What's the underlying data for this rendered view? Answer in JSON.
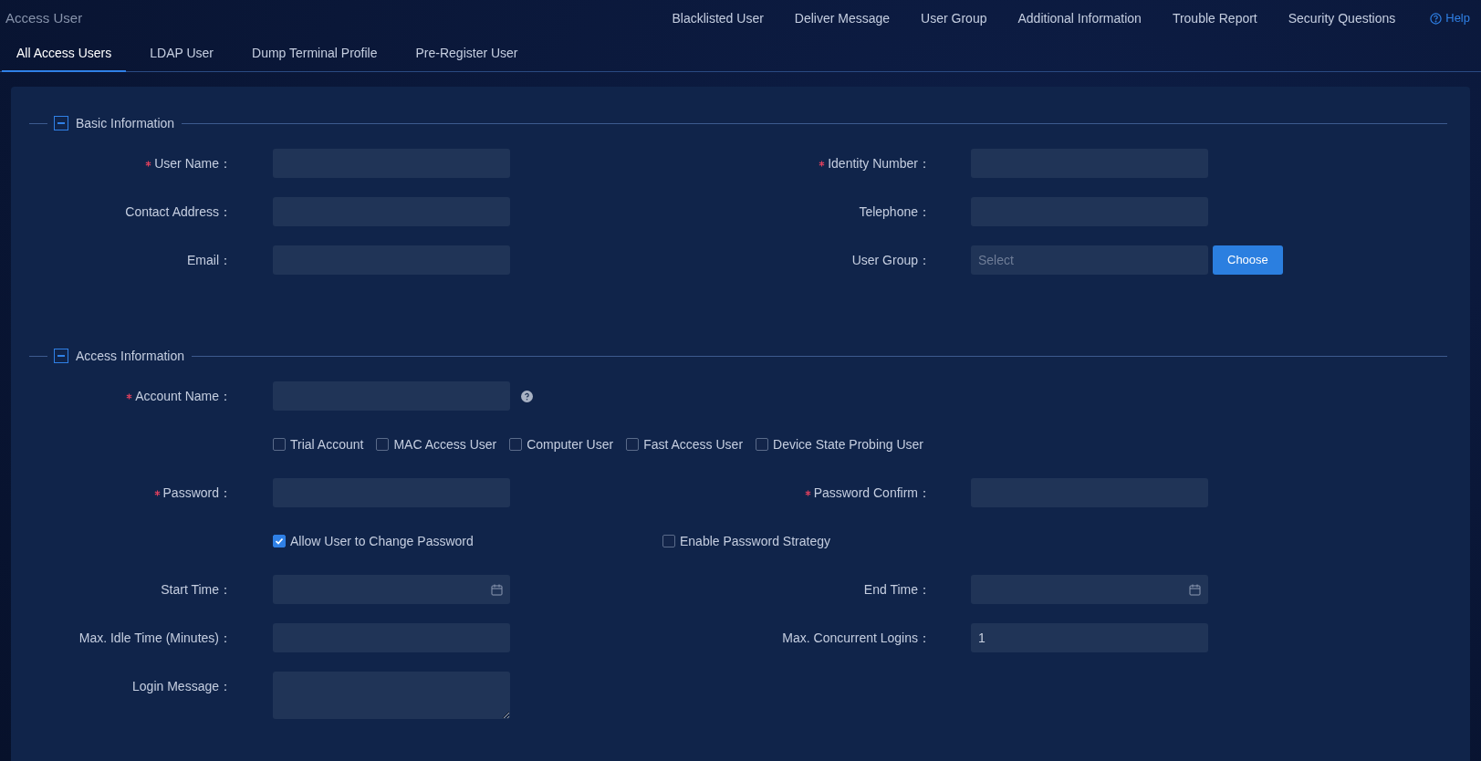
{
  "header": {
    "title": "Access User",
    "nav": [
      "Blacklisted User",
      "Deliver Message",
      "User Group",
      "Additional Information",
      "Trouble Report",
      "Security Questions"
    ],
    "help": "Help"
  },
  "tabs": [
    {
      "label": "All Access Users",
      "selected": true
    },
    {
      "label": "LDAP User",
      "selected": false
    },
    {
      "label": "Dump Terminal Profile",
      "selected": false
    },
    {
      "label": "Pre-Register User",
      "selected": false
    }
  ],
  "sections": [
    {
      "title": "Basic Information",
      "expanded": true,
      "rows": [
        {
          "kind": "fields",
          "fields": [
            {
              "label": "User Name：",
              "required": true,
              "kind": "text"
            },
            {
              "label": "Identity Number：",
              "required": true,
              "kind": "text"
            }
          ]
        },
        {
          "kind": "fields",
          "fields": [
            {
              "label": "Contact Address：",
              "required": false,
              "kind": "text"
            },
            {
              "label": "Telephone：",
              "required": false,
              "kind": "text"
            }
          ]
        },
        {
          "kind": "fields",
          "fields": [
            {
              "label": "Email：",
              "required": false,
              "kind": "text"
            },
            {
              "label": "User Group：",
              "required": false,
              "kind": "select",
              "placeholder": "Select",
              "button": "Choose"
            }
          ]
        }
      ]
    },
    {
      "title": "Access Information",
      "expanded": true,
      "rows": [
        {
          "kind": "fields",
          "fields": [
            {
              "label": "Account Name：",
              "required": true,
              "kind": "text",
              "help": true
            }
          ]
        },
        {
          "kind": "checkboxes",
          "items": [
            {
              "label": "Trial Account",
              "checked": false
            },
            {
              "label": "MAC Access User",
              "checked": false
            },
            {
              "label": "Computer User",
              "checked": false
            },
            {
              "label": "Fast Access User",
              "checked": false
            },
            {
              "label": "Device State Probing User",
              "checked": false
            }
          ]
        },
        {
          "kind": "fields",
          "fields": [
            {
              "label": "Password：",
              "required": true,
              "kind": "text"
            },
            {
              "label": "Password Confirm：",
              "required": true,
              "kind": "text"
            }
          ]
        },
        {
          "kind": "split_checkboxes",
          "items": [
            {
              "label": "Allow User to Change Password",
              "checked": true
            },
            {
              "label": "Enable Password Strategy",
              "checked": false
            }
          ]
        },
        {
          "kind": "fields",
          "fields": [
            {
              "label": "Start Time：",
              "required": false,
              "kind": "date"
            },
            {
              "label": "End Time：",
              "required": false,
              "kind": "date"
            }
          ]
        },
        {
          "kind": "fields",
          "fields": [
            {
              "label": "Max. Idle Time (Minutes)：",
              "required": false,
              "kind": "text"
            },
            {
              "label": "Max. Concurrent Logins：",
              "required": false,
              "kind": "text",
              "value": "1"
            }
          ]
        },
        {
          "kind": "fields",
          "fields": [
            {
              "label": "Login Message：",
              "required": false,
              "kind": "textarea"
            }
          ]
        }
      ]
    }
  ]
}
